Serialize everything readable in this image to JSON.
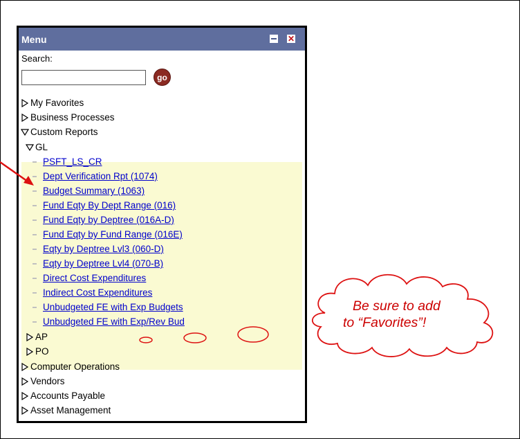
{
  "menu": {
    "title": "Menu",
    "search_label": "Search:",
    "search_value": "",
    "go_label": "go"
  },
  "tree": {
    "top_items": [
      "My Favorites",
      "Business Processes",
      "Custom Reports"
    ],
    "gl_label": "GL",
    "gl_reports": [
      "PSFT_LS_CR",
      "Dept Verification Rpt (1074)",
      "Budget Summary (1063)",
      "Fund Eqty By Dept Range (016)",
      "Fund Eqty by Deptree (016A-D)",
      "Fund Eqty by Fund Range (016E)",
      "Eqty by Deptree Lvl3 (060-D)",
      "Eqty by Deptree Lvl4 (070-B)",
      "Direct Cost Expenditures",
      "Indirect Cost Expenditures",
      "Unbudgeted FE with Exp Budgets",
      "Unbudgeted FE with Exp/Rev Bud"
    ],
    "custom_sub": [
      "AP",
      "PO"
    ],
    "bottom_items": [
      "Computer Operations",
      "Vendors",
      "Accounts Payable",
      "Asset Management"
    ]
  },
  "callout": {
    "line1": "Be sure to add",
    "line2": "to “Favorites”!"
  },
  "colors": {
    "titlebar": "#5f6e9e",
    "link": "#0000cc",
    "highlight": "#fafad2",
    "callout": "#cc0000"
  }
}
